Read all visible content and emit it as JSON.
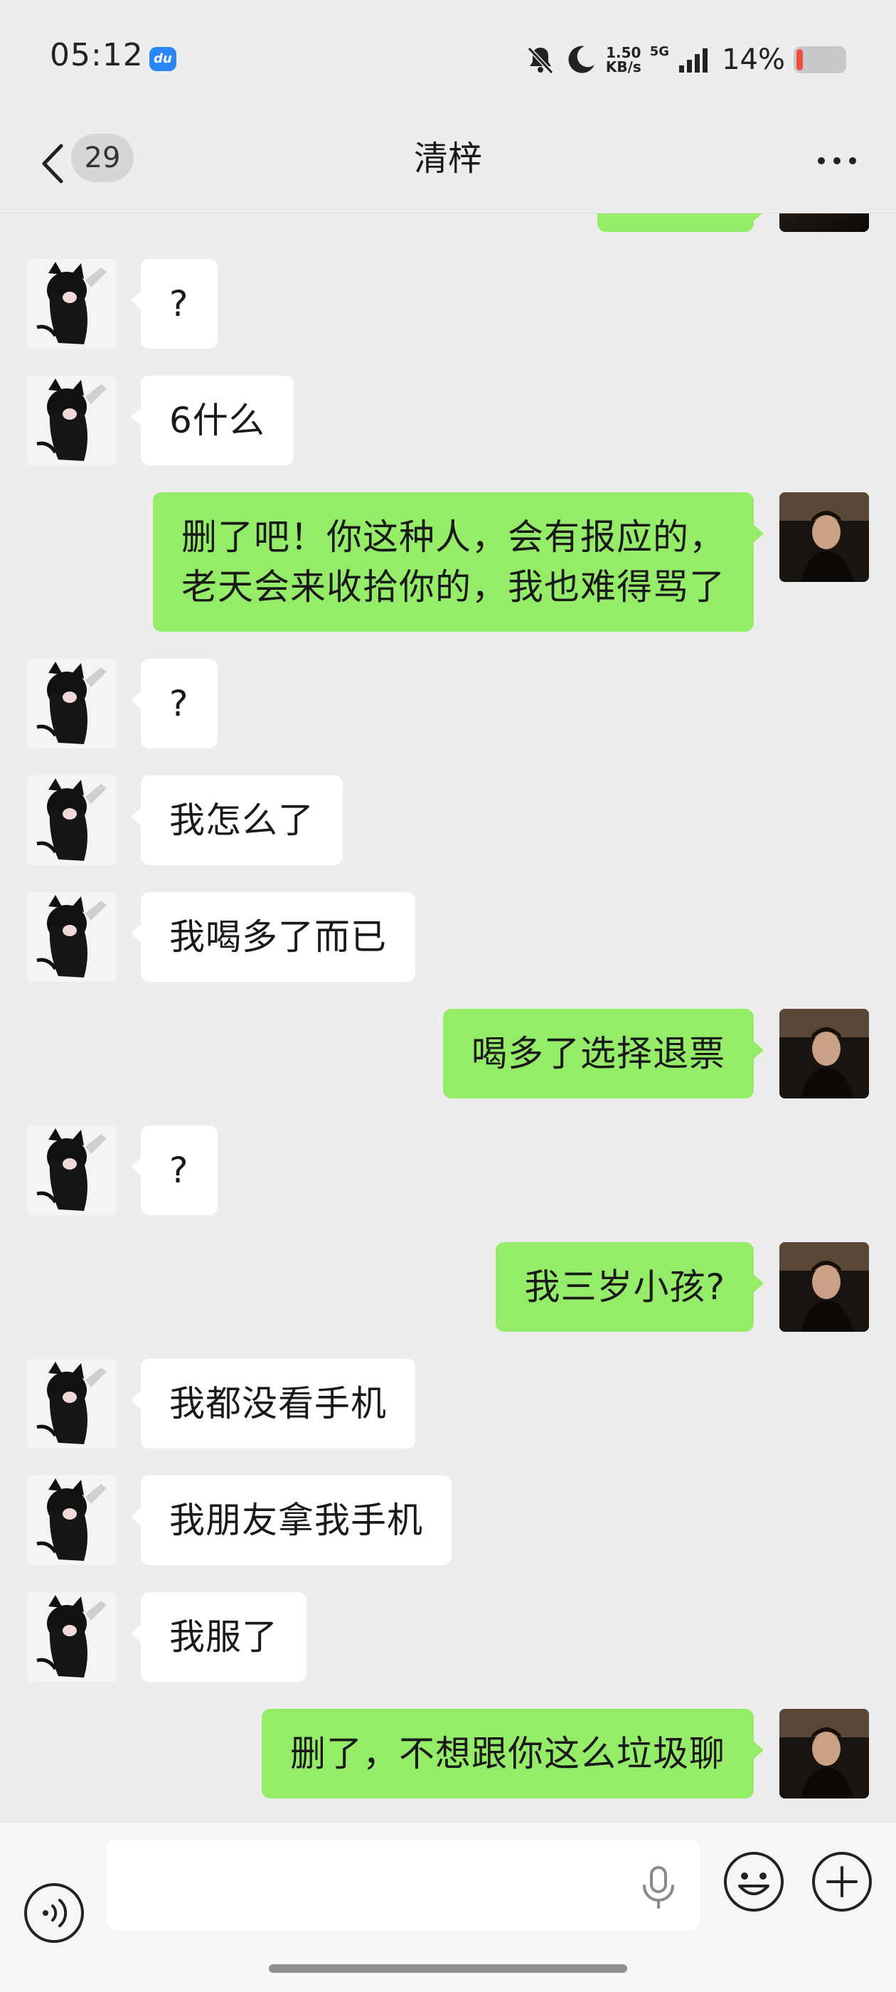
{
  "status_bar": {
    "time": "05:12",
    "app_badge_text": "du",
    "net_speed_value": "1.50",
    "net_speed_unit": "KB/s",
    "network_type": "5G",
    "battery_percent": "14%",
    "battery_level": 0.14,
    "icons": [
      "baidu-app-icon",
      "bell-off-icon",
      "moon-icon",
      "signal-icon",
      "battery-icon"
    ]
  },
  "nav": {
    "back_icon": "chevron-left-icon",
    "unread_count": "29",
    "title": "清梓",
    "more_icon": "more-dots-icon"
  },
  "messages": [
    {
      "side": "left",
      "text": "?"
    },
    {
      "side": "left",
      "text": "6什么"
    },
    {
      "side": "right",
      "text": "删了吧！你这种人，会有报应的，\n老天会来收拾你的，我也难得骂了"
    },
    {
      "side": "left",
      "text": "?"
    },
    {
      "side": "left",
      "text": "我怎么了"
    },
    {
      "side": "left",
      "text": "我喝多了而已"
    },
    {
      "side": "right",
      "text": "喝多了选择退票"
    },
    {
      "side": "left",
      "text": "?"
    },
    {
      "side": "right",
      "text": "我三岁小孩?"
    },
    {
      "side": "left",
      "text": "我都没看手机"
    },
    {
      "side": "left",
      "text": "我朋友拿我手机"
    },
    {
      "side": "left",
      "text": "我服了"
    },
    {
      "side": "right",
      "text": "删了，不想跟你这么垃圾聊"
    }
  ],
  "input_bar": {
    "placeholder": "",
    "icons": [
      "voice-icon",
      "microphone-icon",
      "emoji-icon",
      "plus-icon"
    ]
  },
  "colors": {
    "background": "#ededed",
    "bubble_self": "#95ec69",
    "bubble_other": "#ffffff",
    "battery_low": "#f24a3f"
  }
}
